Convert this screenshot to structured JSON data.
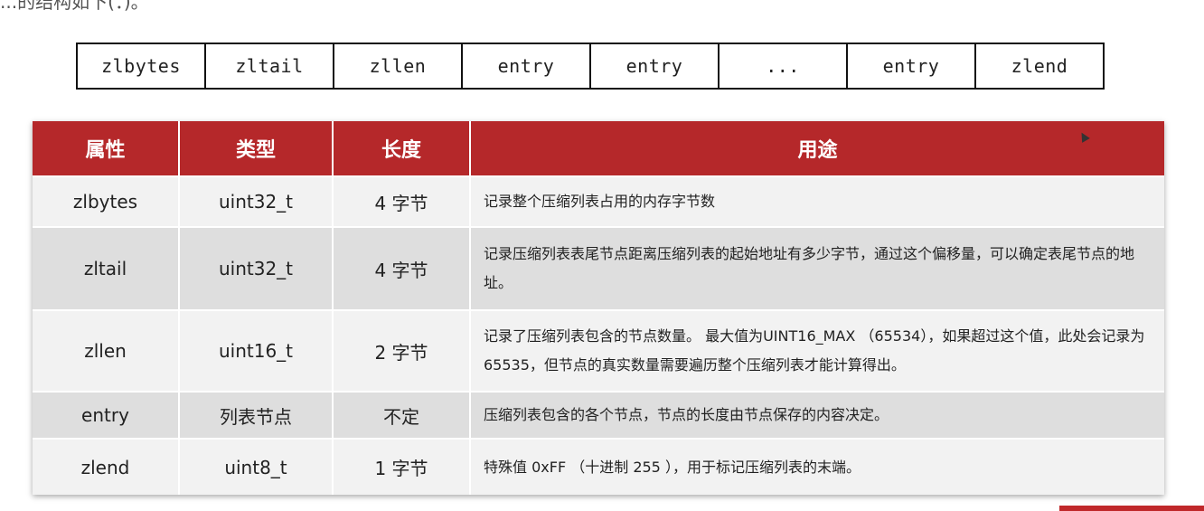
{
  "top_text": "...的结构如下(：)。",
  "structure": [
    "zlbytes",
    "zltail",
    "zllen",
    "entry",
    "entry",
    "...",
    "entry",
    "zlend"
  ],
  "table": {
    "headers": [
      "属性",
      "类型",
      "长度",
      "用途"
    ],
    "rows": [
      [
        "zlbytes",
        "uint32_t",
        "4 字节",
        "记录整个压缩列表占用的内存字节数"
      ],
      [
        "zltail",
        "uint32_t",
        "4 字节",
        "记录压缩列表表尾节点距离压缩列表的起始地址有多少字节，通过这个偏移量，可以确定表尾节点的地址。"
      ],
      [
        "zllen",
        "uint16_t",
        "2 字节",
        "记录了压缩列表包含的节点数量。 最大值为UINT16_MAX （65534），如果超过这个值，此处会记录为65535，但节点的真实数量需要遍历整个压缩列表才能计算得出。"
      ],
      [
        "entry",
        "列表节点",
        "不定",
        "压缩列表包含的各个节点，节点的长度由节点保存的内容决定。"
      ],
      [
        "zlend",
        "uint8_t",
        "1 字节",
        "特殊值 0xFF （十进制 255 ），用于标记压缩列表的末端。"
      ]
    ]
  },
  "colors": {
    "header_bg": "#b5282a",
    "row_light": "#f2f2f2",
    "row_dark": "#dedede"
  }
}
